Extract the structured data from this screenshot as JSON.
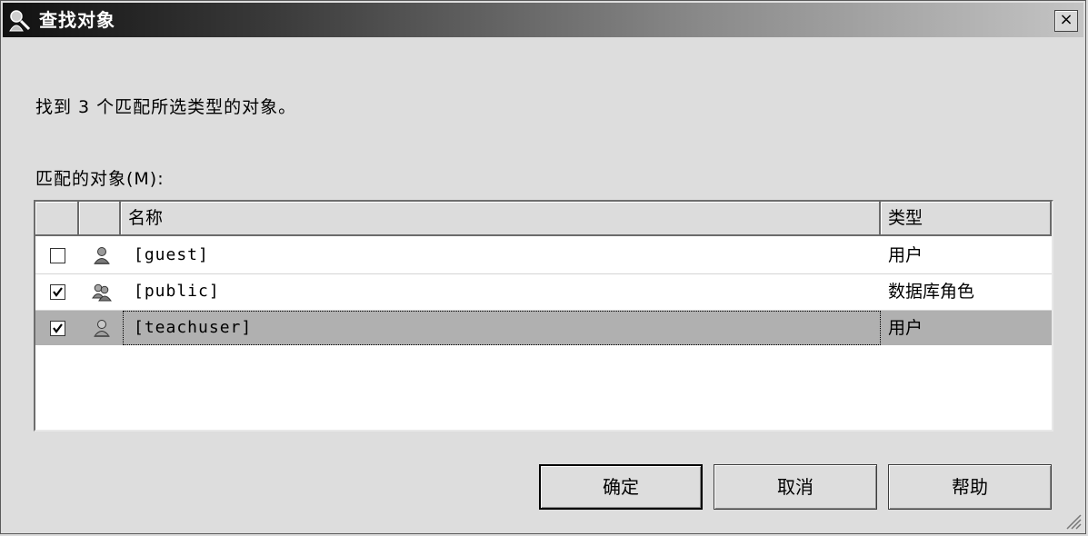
{
  "window": {
    "title": "查找对象",
    "close_label": "×"
  },
  "found_message": "找到 3 个匹配所选类型的对象。",
  "list_label": "匹配的对象(M):",
  "table": {
    "columns": [
      "",
      "",
      "名称",
      "类型"
    ],
    "rows": [
      {
        "checked": false,
        "icon": "user-icon",
        "name": "[guest]",
        "type": "用户",
        "selected": false
      },
      {
        "checked": true,
        "icon": "role-icon",
        "name": "[public]",
        "type": "数据库角色",
        "selected": false
      },
      {
        "checked": true,
        "icon": "user-icon",
        "name": "[teachuser]",
        "type": "用户",
        "selected": true
      }
    ]
  },
  "buttons": {
    "ok": "确定",
    "cancel": "取消",
    "help": "帮助"
  },
  "colors": {
    "selected_row": "#b0b0b0",
    "title_gradient_start": "#111111",
    "title_gradient_end": "#c4c4c4"
  }
}
